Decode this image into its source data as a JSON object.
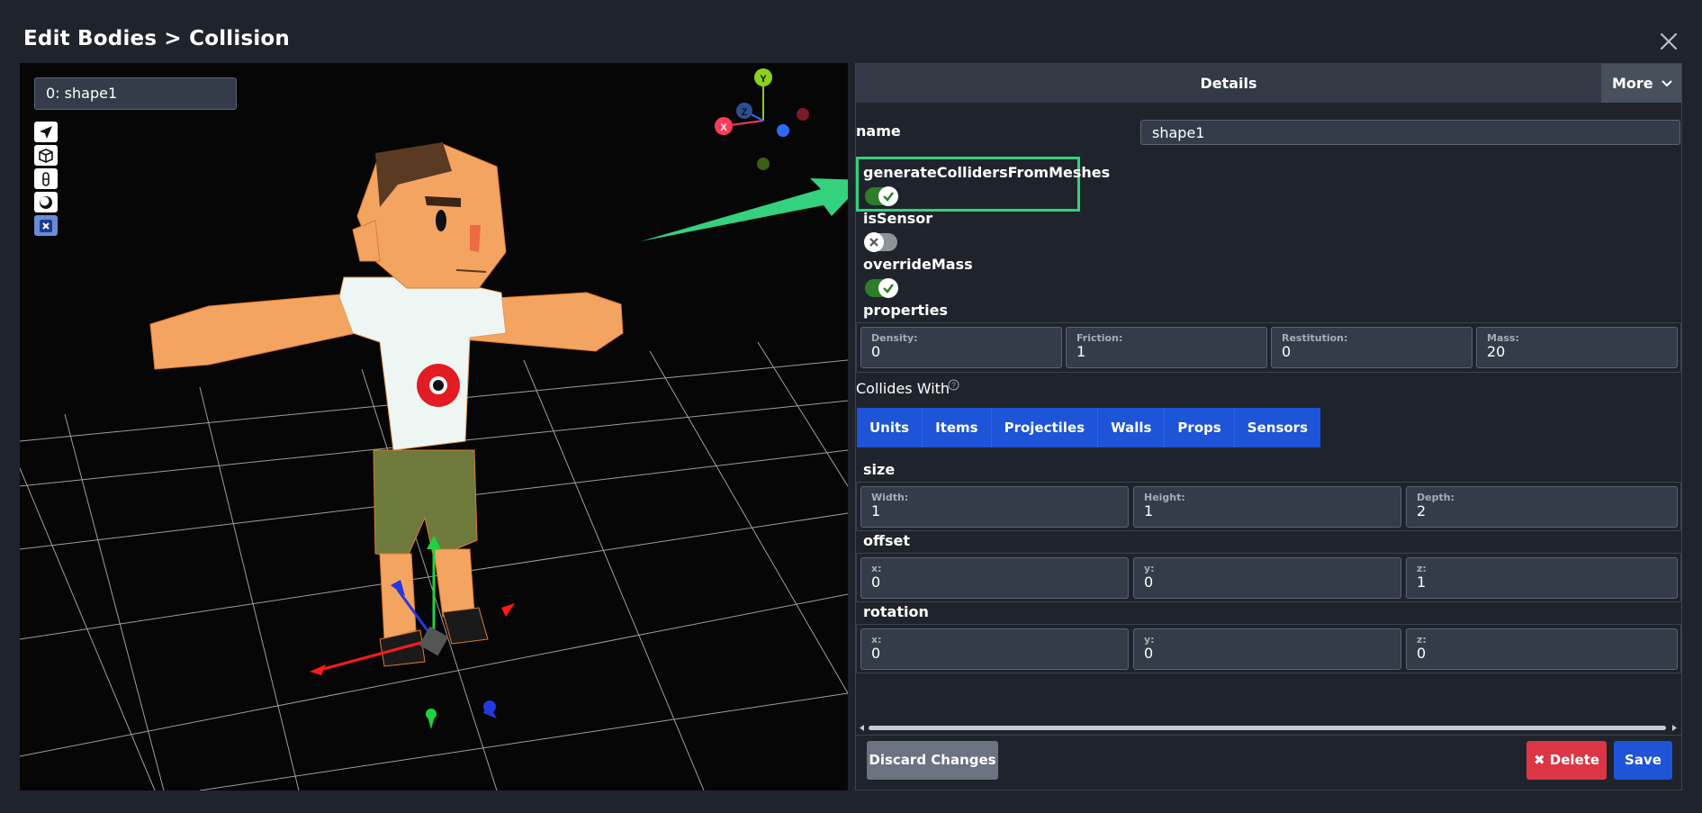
{
  "modal": {
    "title": "Edit Bodies > Collision"
  },
  "viewport": {
    "shape_selector": "0: shape1",
    "tools": [
      "plane-icon",
      "cube-icon",
      "capsule-icon",
      "sphere-icon",
      "close-box-icon"
    ],
    "gizmo_labels": {
      "x": "X",
      "y": "Y",
      "z": "Z"
    }
  },
  "details": {
    "header": "Details",
    "more_label": "More",
    "name_label": "name",
    "name_value": "shape1",
    "generate_colliders_label": "generateCollidersFromMeshes",
    "generate_colliders_on": true,
    "is_sensor_label": "isSensor",
    "is_sensor_on": false,
    "override_mass_label": "overrideMass",
    "override_mass_on": true,
    "properties_label": "properties",
    "properties": [
      {
        "label": "Density:",
        "value": "0"
      },
      {
        "label": "Friction:",
        "value": "1"
      },
      {
        "label": "Restitution:",
        "value": "0"
      },
      {
        "label": "Mass:",
        "value": "20"
      }
    ],
    "collides_with_label": "Collides With",
    "collides_with": [
      "Units",
      "Items",
      "Projectiles",
      "Walls",
      "Props",
      "Sensors"
    ],
    "size_label": "size",
    "size": [
      {
        "label": "Width:",
        "value": "1"
      },
      {
        "label": "Height:",
        "value": "1"
      },
      {
        "label": "Depth:",
        "value": "2"
      }
    ],
    "offset_label": "offset",
    "offset": [
      {
        "label": "x:",
        "value": "0"
      },
      {
        "label": "y:",
        "value": "0"
      },
      {
        "label": "z:",
        "value": "1"
      }
    ],
    "rotation_label": "rotation",
    "rotation": [
      {
        "label": "x:",
        "value": "0"
      },
      {
        "label": "y:",
        "value": "0"
      },
      {
        "label": "z:",
        "value": "0"
      }
    ]
  },
  "footer": {
    "discard_label": "Discard Changes",
    "delete_label": "Delete",
    "save_label": "Save"
  },
  "colors": {
    "accent_blue": "#1d54d8",
    "delete_red": "#dc3545",
    "highlight_green": "#34d17e",
    "toggle_on": "#2e7d28"
  }
}
